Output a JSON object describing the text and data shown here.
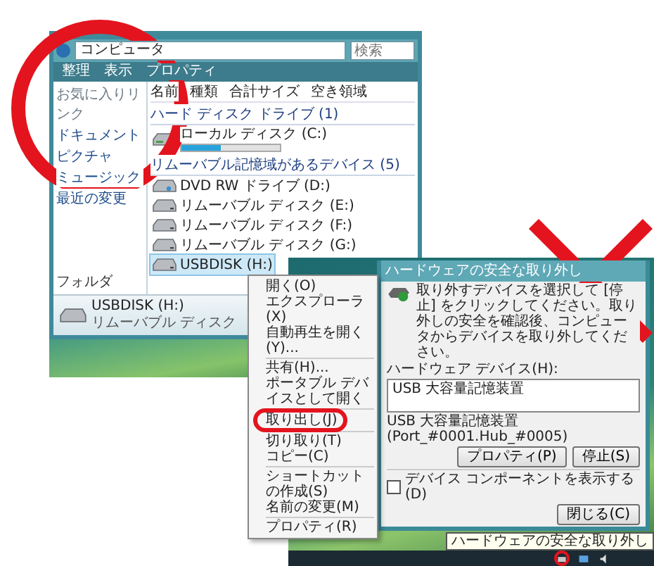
{
  "explorer": {
    "address": "コンピュータ",
    "search_placeholder": "検索",
    "toolbar": [
      "整理",
      "表示",
      "プロパティ"
    ],
    "sidebar": {
      "heading": "お気に入りリンク",
      "links": [
        "ドキュメント",
        "ピクチャ",
        "ミュージック",
        "最近の変更"
      ],
      "folders": "フォルダ"
    },
    "columns": [
      "名前",
      "種類",
      "合計サイズ",
      "空き領域"
    ],
    "groups": [
      {
        "title": "ハード ディスク ドライブ (1)",
        "drives": [
          {
            "name": "ローカル ディスク (C:)",
            "kind": "disk",
            "level": 0.4,
            "selected": false
          }
        ]
      },
      {
        "title": "リムーバブル記憶域があるデバイス (5)",
        "drives": [
          {
            "name": "DVD RW ドライブ (D:)",
            "kind": "optical",
            "selected": false
          },
          {
            "name": "リムーバブル ディスク (E:)",
            "kind": "removable",
            "selected": false
          },
          {
            "name": "リムーバブル ディスク (F:)",
            "kind": "removable",
            "selected": false
          },
          {
            "name": "リムーバブル ディスク (G:)",
            "kind": "removable",
            "selected": false
          },
          {
            "name": "USBDISK (H:)",
            "kind": "removable",
            "selected": true
          }
        ]
      }
    ],
    "details": {
      "name": "USBDISK (H:)",
      "type": "リムーバブル ディスク"
    }
  },
  "context_menu": {
    "items": [
      {
        "kind": "item",
        "label": "開く(O)",
        "highlighted": false
      },
      {
        "kind": "item",
        "label": "エクスプローラ(X)",
        "highlighted": false
      },
      {
        "kind": "item",
        "label": "自動再生を開く(Y)...",
        "highlighted": false
      },
      {
        "kind": "separator"
      },
      {
        "kind": "item",
        "label": "共有(H)...",
        "highlighted": false
      },
      {
        "kind": "item",
        "label": "ポータブル デバイスとして開く",
        "highlighted": false
      },
      {
        "kind": "separator"
      },
      {
        "kind": "item",
        "label": "取り出し(J)",
        "highlighted": true
      },
      {
        "kind": "separator"
      },
      {
        "kind": "item",
        "label": "切り取り(T)",
        "highlighted": false
      },
      {
        "kind": "item",
        "label": "コピー(C)",
        "highlighted": false
      },
      {
        "kind": "separator"
      },
      {
        "kind": "item",
        "label": "ショートカットの作成(S)",
        "highlighted": false
      },
      {
        "kind": "item",
        "label": "名前の変更(M)",
        "highlighted": false
      },
      {
        "kind": "separator"
      },
      {
        "kind": "item",
        "label": "プロパティ(R)",
        "highlighted": false
      }
    ]
  },
  "dialog": {
    "title": "ハードウェアの安全な取り外し",
    "instruction": "取り外すデバイスを選択して [停止] をクリックしてください。取り外しの安全を確認後、コンピュータからデバイスを取り外してください。",
    "list_label": "ハードウェア デバイス(H):",
    "devices": [
      {
        "name": "USB 大容量記憶装置",
        "selected": false
      }
    ],
    "device_info": "USB 大容量記憶装置 (Port_#0001.Hub_#0005)",
    "buttons": [
      "プロパティ(P)",
      "停止(S)"
    ],
    "show_components": {
      "label": "デバイス コンポーネントを表示する(D)",
      "checked": false
    },
    "close": "閉じる(C)"
  },
  "taskbar": {
    "tooltip": "ハードウェアの安全な取り外し",
    "tray_icons": [
      {
        "kind": "remove",
        "highlighted": true
      },
      {
        "kind": "network",
        "highlighted": false
      },
      {
        "kind": "volume",
        "highlighted": false
      }
    ]
  }
}
